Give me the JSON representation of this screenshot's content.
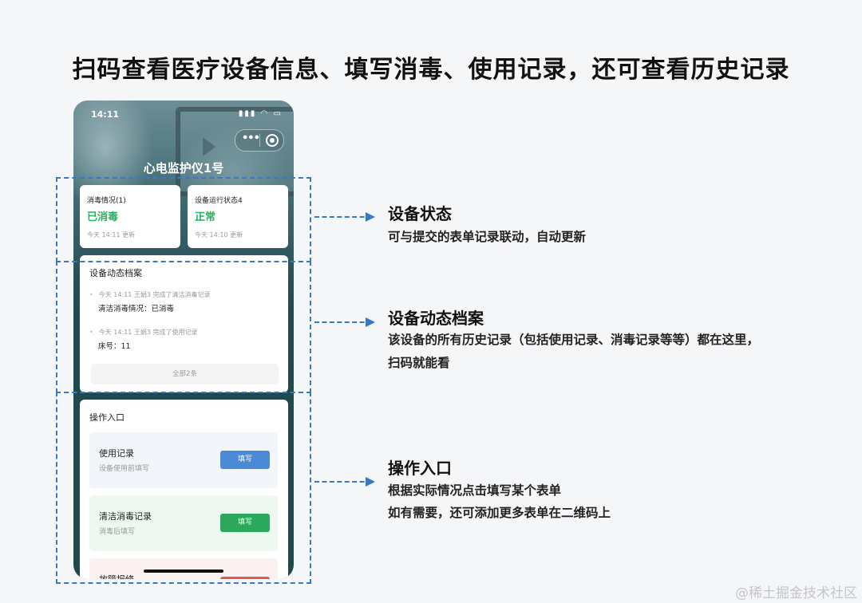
{
  "page_title": "扫码查看医疗设备信息、填写消毒、使用记录，还可查看历史记录",
  "phone": {
    "status_time": "14:11",
    "device_name": "心电监护仪1号",
    "status_cards": [
      {
        "title": "消毒情况(1)",
        "value": "已消毒",
        "time": "今天 14:11 更新"
      },
      {
        "title": "设备运行状态4",
        "value": "正常",
        "time": "今天 14:10 更新"
      }
    ],
    "archive": {
      "title": "设备动态档案",
      "items": [
        {
          "meta": "今天 14:11  王娟3 完成了清洁消毒记录",
          "detail": "清洁消毒情况：已消毒"
        },
        {
          "meta": "今天 14:11  王娟3 完成了使用记录",
          "detail": "床号：11"
        }
      ],
      "view_all": "全部2条"
    },
    "ops": {
      "title": "操作入口",
      "entries": [
        {
          "title": "使用记录",
          "subtitle": "设备使用前填写",
          "button": "填写",
          "button_color": "#4a8ad6",
          "bg": "#f2f6fa"
        },
        {
          "title": "清洁消毒记录",
          "subtitle": "消毒后填写",
          "button": "填写",
          "button_color": "#2ba85a",
          "bg": "#eef7f0"
        },
        {
          "title": "故障报修",
          "button_color": "#e05a4e",
          "bg": "#fbf1f0"
        }
      ]
    }
  },
  "annotations": [
    {
      "title": "设备状态",
      "lines": [
        "可与提交的表单记录联动，自动更新"
      ]
    },
    {
      "title": "设备动态档案",
      "lines": [
        "该设备的所有历史记录（包括使用记录、消毒记录等等）都在这里，",
        "扫码就能看"
      ]
    },
    {
      "title": "操作入口",
      "lines": [
        "根据实际情况点击填写某个表单",
        "如有需要，还可添加更多表单在二维码上"
      ]
    }
  ],
  "watermark": "@稀土掘金技术社区",
  "accent_color": "#3a78c2"
}
